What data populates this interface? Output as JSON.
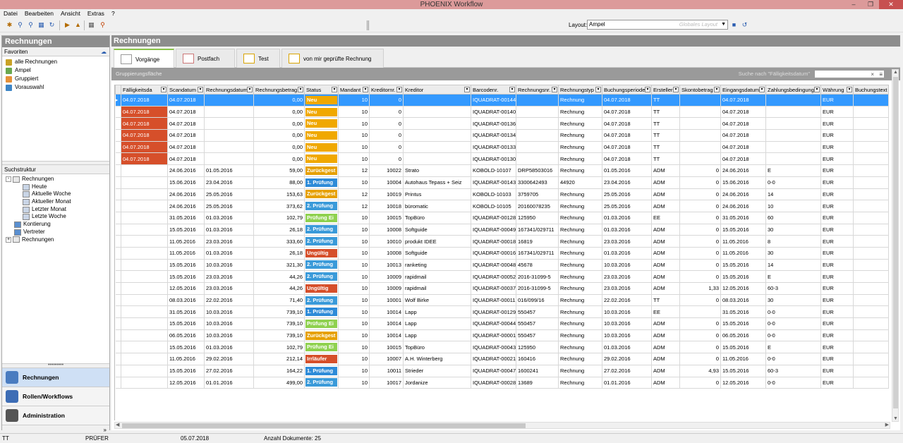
{
  "window": {
    "title": "PHOENIX Workflow"
  },
  "menu": [
    "Datei",
    "Bearbeiten",
    "Ansicht",
    "Extras",
    "?"
  ],
  "layout": {
    "label": "Layout:",
    "value": "Ampel",
    "hint": "Globales Layout"
  },
  "sidebar": {
    "title": "Rechnungen",
    "favorites_title": "Favoriten",
    "favorites": [
      {
        "label": "alle Rechnungen",
        "color": "#c9a227"
      },
      {
        "label": "Ampel",
        "color": "#6aa84f"
      },
      {
        "label": "Gruppiert",
        "color": "#e69138"
      },
      {
        "label": "Vorauswahl",
        "color": "#3d85c6"
      }
    ],
    "structure_title": "Suchstruktur",
    "tree": [
      {
        "label": "Rechnungen",
        "level": 0,
        "expander": "-"
      },
      {
        "label": "Heute",
        "level": 2,
        "expander": ""
      },
      {
        "label": "Aktuelle Woche",
        "level": 2,
        "expander": ""
      },
      {
        "label": "Aktueller Monat",
        "level": 2,
        "expander": ""
      },
      {
        "label": "Letzter Monat",
        "level": 2,
        "expander": ""
      },
      {
        "label": "Letzte Woche",
        "level": 2,
        "expander": ""
      },
      {
        "label": "Kontierung",
        "level": 1,
        "expander": ""
      },
      {
        "label": "Vertreter",
        "level": 1,
        "expander": ""
      },
      {
        "label": "Rechnungen",
        "level": 0,
        "expander": "+"
      }
    ],
    "nav": [
      {
        "label": "Rechnungen",
        "active": true,
        "color": "#4a7cc0"
      },
      {
        "label": "Rollen/Workflows",
        "active": false,
        "color": "#3d6db5"
      },
      {
        "label": "Administration",
        "active": false,
        "color": "#555555"
      }
    ]
  },
  "main": {
    "title": "Rechnungen",
    "tabs": [
      "Vorgänge",
      "Postfach",
      "Test",
      "von mir geprüfte Rechnung"
    ],
    "group_hint": "Gruppierungsfläche",
    "search_hint": "Suche nach \"Fälligkeitsdatum\"",
    "columns": [
      "Fälligkeitsda",
      "Scandatum",
      "Rechnungsdatum",
      "Rechnungsbetrag",
      "Status",
      "Mandant",
      "Kreditornr.",
      "Kreditor",
      "Barcodenr.",
      "Rechnungsnr.",
      "Rechnungstyp",
      "Buchungsperiode",
      "Ersteller",
      "Skontobetrag",
      "Eingangsdatum",
      "Zahlungsbedingung",
      "Währung",
      "Buchungstext"
    ],
    "status_colors": {
      "Neu": "#f0a800",
      "Zurückgest": "#e6a000",
      "1. Prüfung": "#2e8bd8",
      "2. Prüfung": "#3a9ad9",
      "Prüfung Ei": "#8fd14f",
      "Ungültig": "#d64f2a",
      "Irrläufer": "#d64f2a"
    },
    "rows": [
      [
        "04.07.2018",
        "04.07.2018",
        "",
        "0,00",
        "Neu",
        "10",
        "0",
        "",
        "IQUADRAT-00144",
        "",
        "Rechnung",
        "04.07.2018",
        "TT",
        "",
        "04.07.2018",
        "",
        "EUR",
        ""
      ],
      [
        "04.07.2018",
        "04.07.2018",
        "",
        "0,00",
        "Neu",
        "10",
        "0",
        "",
        "IQUADRAT-00140",
        "",
        "Rechnung",
        "04.07.2018",
        "TT",
        "",
        "04.07.2018",
        "",
        "EUR",
        ""
      ],
      [
        "04.07.2018",
        "04.07.2018",
        "",
        "0,00",
        "Neu",
        "10",
        "0",
        "",
        "IQUADRAT-00136",
        "",
        "Rechnung",
        "04.07.2018",
        "TT",
        "",
        "04.07.2018",
        "",
        "EUR",
        ""
      ],
      [
        "04.07.2018",
        "04.07.2018",
        "",
        "0,00",
        "Neu",
        "10",
        "0",
        "",
        "IQUADRAT-00134",
        "",
        "Rechnung",
        "04.07.2018",
        "TT",
        "",
        "04.07.2018",
        "",
        "EUR",
        ""
      ],
      [
        "04.07.2018",
        "04.07.2018",
        "",
        "0,00",
        "Neu",
        "10",
        "0",
        "",
        "IQUADRAT-00133",
        "",
        "Rechnung",
        "04.07.2018",
        "TT",
        "",
        "04.07.2018",
        "",
        "EUR",
        ""
      ],
      [
        "04.07.2018",
        "04.07.2018",
        "",
        "0,00",
        "Neu",
        "10",
        "0",
        "",
        "IQUADRAT-00130",
        "",
        "Rechnung",
        "04.07.2018",
        "TT",
        "",
        "04.07.2018",
        "",
        "EUR",
        ""
      ],
      [
        "",
        "24.06.2016",
        "01.05.2016",
        "59,00",
        "Zurückgest",
        "12",
        "10022",
        "Strato",
        "KOBOLD-10107",
        "DRP58503016",
        "Rechnung",
        "01.05.2016",
        "ADM",
        "0",
        "24.06.2016",
        "E",
        "EUR",
        ""
      ],
      [
        "",
        "15.06.2016",
        "23.04.2016",
        "88,00",
        "1. Prüfung",
        "10",
        "10004",
        "Autohaus Tepass + Seiz",
        "IQUADRAT-00143",
        "3300642493",
        "44920",
        "23.04.2016",
        "ADM",
        "0",
        "15.06.2016",
        "0-0",
        "EUR",
        ""
      ],
      [
        "",
        "24.06.2016",
        "25.05.2016",
        "153,63",
        "Zurückgest",
        "12",
        "10019",
        "Printus",
        "KOBOLD-10103",
        "3759705",
        "Rechnung",
        "25.05.2016",
        "ADM",
        "0",
        "24.06.2016",
        "14",
        "EUR",
        ""
      ],
      [
        "",
        "24.06.2016",
        "25.05.2016",
        "373,62",
        "2. Prüfung",
        "12",
        "10018",
        "büromatic",
        "KOBOLD-10105",
        "20160078235",
        "Rechnung",
        "25.05.2016",
        "ADM",
        "0",
        "24.06.2016",
        "10",
        "EUR",
        ""
      ],
      [
        "",
        "31.05.2016",
        "01.03.2016",
        "102,79",
        "Prüfung Ei",
        "10",
        "10015",
        "TopBüro",
        "IQUADRAT-00128",
        "125950",
        "Rechnung",
        "01.03.2016",
        "EE",
        "0",
        "31.05.2016",
        "60",
        "EUR",
        ""
      ],
      [
        "",
        "15.05.2016",
        "01.03.2016",
        "26,18",
        "2. Prüfung",
        "10",
        "10008",
        "Softguide",
        "IQUADRAT-00049",
        "167341/029711",
        "Rechnung",
        "01.03.2016",
        "ADM",
        "0",
        "15.05.2016",
        "30",
        "EUR",
        ""
      ],
      [
        "",
        "11.05.2016",
        "23.03.2016",
        "333,60",
        "2. Prüfung",
        "10",
        "10010",
        "produkt IDEE",
        "IQUADRAT-00018",
        "16819",
        "Rechnung",
        "23.03.2016",
        "ADM",
        "0",
        "11.05.2016",
        "8",
        "EUR",
        ""
      ],
      [
        "",
        "11.05.2016",
        "01.03.2016",
        "26,18",
        "Ungültig",
        "10",
        "10008",
        "Softguide",
        "IQUADRAT-00016",
        "167341/029711",
        "Rechnung",
        "01.03.2016",
        "ADM",
        "0",
        "11.05.2016",
        "30",
        "EUR",
        ""
      ],
      [
        "",
        "15.05.2016",
        "10.03.2016",
        "321,30",
        "2. Prüfung",
        "10",
        "10013",
        "ranketing",
        "IQUADRAT-00048",
        "45678",
        "Rechnung",
        "10.03.2016",
        "ADM",
        "0",
        "15.05.2016",
        "14",
        "EUR",
        ""
      ],
      [
        "",
        "15.05.2016",
        "23.03.2016",
        "44,26",
        "2. Prüfung",
        "10",
        "10009",
        "rapidmail",
        "IQUADRAT-00052",
        "2016-31099-5",
        "Rechnung",
        "23.03.2016",
        "ADM",
        "0",
        "15.05.2016",
        "E",
        "EUR",
        ""
      ],
      [
        "",
        "12.05.2016",
        "23.03.2016",
        "44,26",
        "Ungültig",
        "10",
        "10009",
        "rapidmail",
        "IQUADRAT-00037",
        "2016-31099-5",
        "Rechnung",
        "23.03.2016",
        "ADM",
        "1,33",
        "12.05.2016",
        "60-3",
        "EUR",
        ""
      ],
      [
        "",
        "08.03.2016",
        "22.02.2016",
        "71,40",
        "2. Prüfung",
        "10",
        "10001",
        "Wolf Birke",
        "IQUADRAT-00011",
        "016/099/16",
        "Rechnung",
        "22.02.2016",
        "TT",
        "0",
        "08.03.2016",
        "30",
        "EUR",
        ""
      ],
      [
        "",
        "31.05.2016",
        "10.03.2016",
        "739,10",
        "1. Prüfung",
        "10",
        "10014",
        "Lapp",
        "IQUADRAT-00129",
        "550457",
        "Rechnung",
        "10.03.2016",
        "EE",
        "",
        "31.05.2016",
        "0-0",
        "EUR",
        ""
      ],
      [
        "",
        "15.05.2016",
        "10.03.2016",
        "739,10",
        "Prüfung Ei",
        "10",
        "10014",
        "Lapp",
        "IQUADRAT-00044",
        "550457",
        "Rechnung",
        "10.03.2016",
        "ADM",
        "0",
        "15.05.2016",
        "0-0",
        "EUR",
        ""
      ],
      [
        "",
        "06.05.2016",
        "10.03.2016",
        "739,10",
        "Zurückgest",
        "10",
        "10014",
        "Lapp",
        "IQUADRAT-00001",
        "550457",
        "Rechnung",
        "10.03.2016",
        "ADM",
        "0",
        "06.05.2016",
        "0-0",
        "EUR",
        ""
      ],
      [
        "",
        "15.05.2016",
        "01.03.2016",
        "102,79",
        "Prüfung Ei",
        "10",
        "10015",
        "TopBüro",
        "IQUADRAT-00043",
        "125950",
        "Rechnung",
        "01.03.2016",
        "ADM",
        "0",
        "15.05.2016",
        "E",
        "EUR",
        ""
      ],
      [
        "",
        "11.05.2016",
        "29.02.2016",
        "212,14",
        "Irrläufer",
        "10",
        "10007",
        "A.H. Winterberg",
        "IQUADRAT-00021",
        "160416",
        "Rechnung",
        "29.02.2016",
        "ADM",
        "0",
        "11.05.2016",
        "0-0",
        "EUR",
        ""
      ],
      [
        "",
        "15.05.2016",
        "27.02.2016",
        "164,22",
        "1. Prüfung",
        "10",
        "10011",
        "Strieder",
        "IQUADRAT-00047",
        "1600241",
        "Rechnung",
        "27.02.2016",
        "ADM",
        "4,93",
        "15.05.2016",
        "60-3",
        "EUR",
        ""
      ],
      [
        "",
        "12.05.2016",
        "01.01.2016",
        "499,00",
        "2. Prüfung",
        "10",
        "10017",
        "Jordanize",
        "IQUADRAT-00028",
        "13689",
        "Rechnung",
        "01.01.2016",
        "ADM",
        "0",
        "12.05.2016",
        "0-0",
        "EUR",
        ""
      ]
    ]
  },
  "status": {
    "user": "TT",
    "role": "PRÜFER",
    "date": "05.07.2018",
    "count": "Anzahl Dokumente: 25"
  }
}
